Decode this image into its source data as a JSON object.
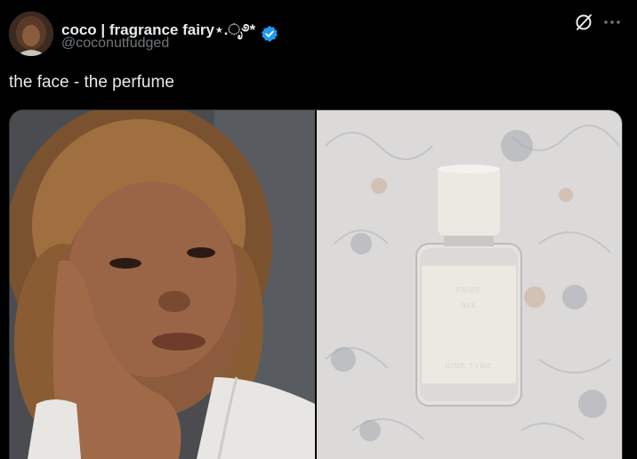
{
  "author": {
    "display_name": "coco | fragrance fairy⋆.ೃ࿔*",
    "handle": "@coconutfudged",
    "verified": true,
    "verified_color": "#1d9bf0"
  },
  "tweet": {
    "text": "the face - the perfume"
  },
  "media": {
    "count": 2,
    "images": [
      "selfie-photo",
      "perfume-bottle-photo"
    ],
    "bottle_label": {
      "name": "FAIRE",
      "number": "014",
      "brand": "DIME TYME"
    }
  },
  "icons": {
    "grok": "grok-icon",
    "more": "more-icon"
  },
  "colors": {
    "background": "#000000",
    "text_primary": "#e7e9ea",
    "text_secondary": "#71767b",
    "accent": "#1d9bf0"
  }
}
